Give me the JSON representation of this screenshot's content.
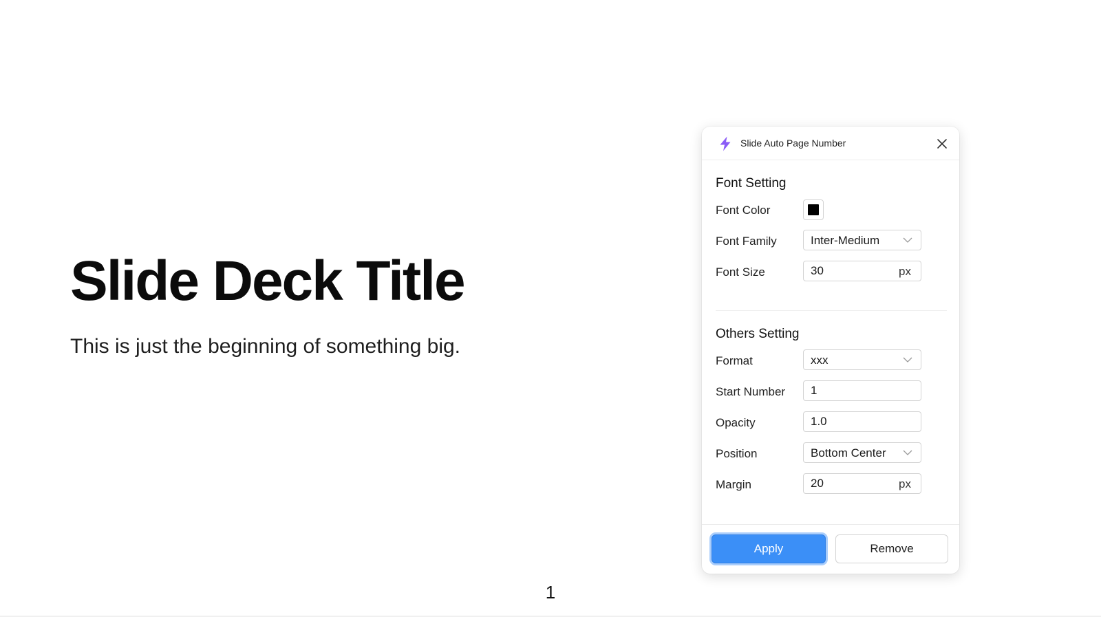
{
  "slide": {
    "title": "Slide Deck Title",
    "subtitle": "This is just the beginning of something big.",
    "page_number": "1"
  },
  "panel": {
    "title": "Slide Auto Page Number",
    "icon": "lightning-bolt-icon",
    "accent_color": "#8b5cf6",
    "font_setting": {
      "heading": "Font Setting",
      "font_color": {
        "label": "Font Color",
        "value": "#000000"
      },
      "font_family": {
        "label": "Font Family",
        "value": "Inter-Medium"
      },
      "font_size": {
        "label": "Font Size",
        "value": "30",
        "unit": "px"
      }
    },
    "others_setting": {
      "heading": "Others Setting",
      "format": {
        "label": "Format",
        "value": "xxx"
      },
      "start_number": {
        "label": "Start Number",
        "value": "1"
      },
      "opacity": {
        "label": "Opacity",
        "value": "1.0"
      },
      "position": {
        "label": "Position",
        "value": "Bottom Center"
      },
      "margin": {
        "label": "Margin",
        "value": "20",
        "unit": "px"
      }
    },
    "buttons": {
      "apply": "Apply",
      "remove": "Remove"
    },
    "button_color": "#3b8ff7"
  }
}
